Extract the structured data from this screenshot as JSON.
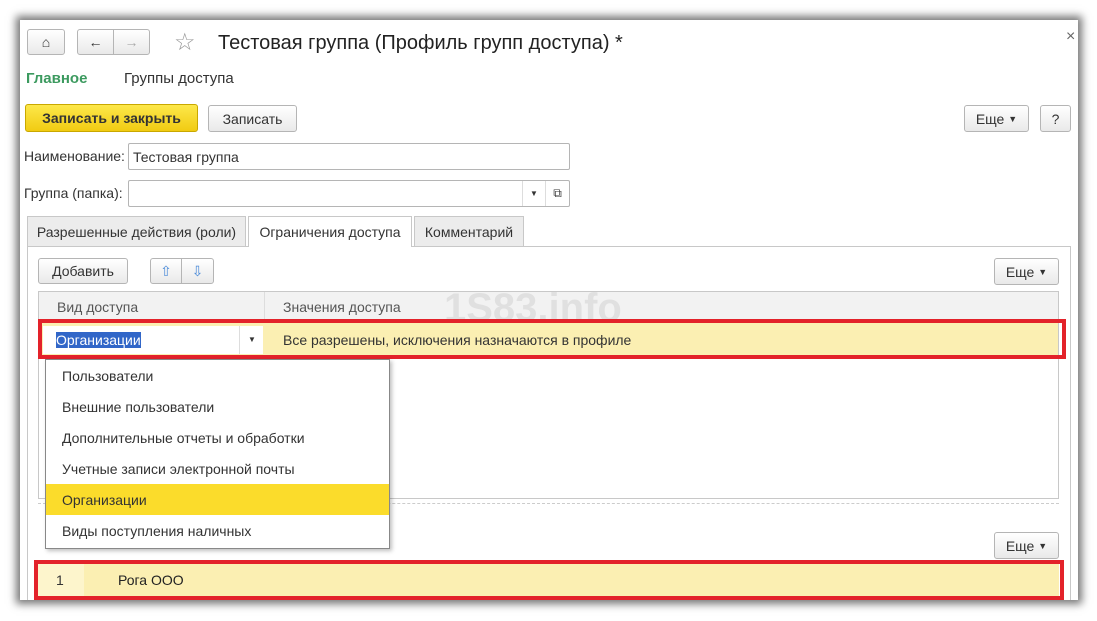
{
  "window": {
    "title": "Тестовая группа (Профиль групп доступа) *",
    "close": "×"
  },
  "nav": {
    "main": "Главное",
    "groups": "Группы доступа"
  },
  "toolbar": {
    "save_close": "Записать и закрыть",
    "save": "Записать",
    "more": "Еще",
    "help": "?"
  },
  "form": {
    "name_label": "Наименование:",
    "name_value": "Тестовая группа",
    "folder_label": "Группа (папка):",
    "folder_value": ""
  },
  "tabs": [
    "Разрешенные действия (роли)",
    "Ограничения доступа",
    "Комментарий"
  ],
  "access": {
    "add": "Добавить",
    "more": "Еще",
    "col1": "Вид доступа",
    "col2": "Значения доступа",
    "row_kind": "Организации",
    "row_value": "Все разрешены, исключения назначаются в профиле"
  },
  "dropdown": [
    "Пользователи",
    "Внешние пользователи",
    "Дополнительные отчеты и обработки",
    "Учетные записи электронной почты",
    "Организации",
    "Виды поступления наличных"
  ],
  "dropdown_selected": 4,
  "values": {
    "more": "Еще",
    "rows": [
      {
        "n": "1",
        "name": "Рога ООО"
      }
    ]
  },
  "watermark": "1S83.info"
}
